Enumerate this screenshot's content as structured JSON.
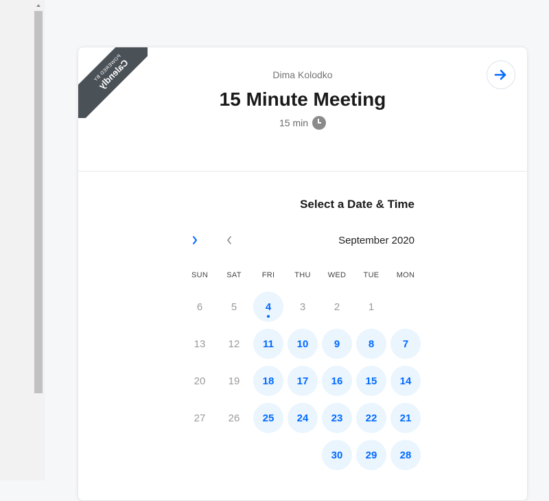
{
  "badge": {
    "small": "POWERED BY",
    "large": "Calendly"
  },
  "host": {
    "name": "Dima Kolodko"
  },
  "event": {
    "title": "15 Minute Meeting",
    "duration": "15 min"
  },
  "icons": {
    "next": "arrow-right-icon",
    "clock": "clock-icon",
    "prev_month": "chevron-left-icon",
    "next_month": "chevron-right-icon"
  },
  "calendar": {
    "section_title": "Select a Date & Time",
    "month": "September 2020",
    "weekdays": [
      "MON",
      "TUE",
      "WED",
      "THU",
      "FRI",
      "SAT",
      "SUN"
    ],
    "weeks": [
      [
        "",
        "1",
        "2",
        "3",
        "4",
        "5",
        "6"
      ],
      [
        "7",
        "8",
        "9",
        "10",
        "11",
        "12",
        "13"
      ],
      [
        "14",
        "15",
        "16",
        "17",
        "18",
        "19",
        "20"
      ],
      [
        "21",
        "22",
        "23",
        "24",
        "25",
        "26",
        "27"
      ],
      [
        "28",
        "29",
        "30",
        "",
        "",
        "",
        ""
      ]
    ],
    "today": "4",
    "available_days": [
      "4",
      "7",
      "8",
      "9",
      "10",
      "11",
      "14",
      "15",
      "16",
      "17",
      "18",
      "21",
      "22",
      "23",
      "24",
      "25",
      "28",
      "29",
      "30"
    ]
  },
  "colors": {
    "accent": "#0069ff",
    "available_bg": "#eaf5fe",
    "badge_bg": "#4a5157"
  }
}
